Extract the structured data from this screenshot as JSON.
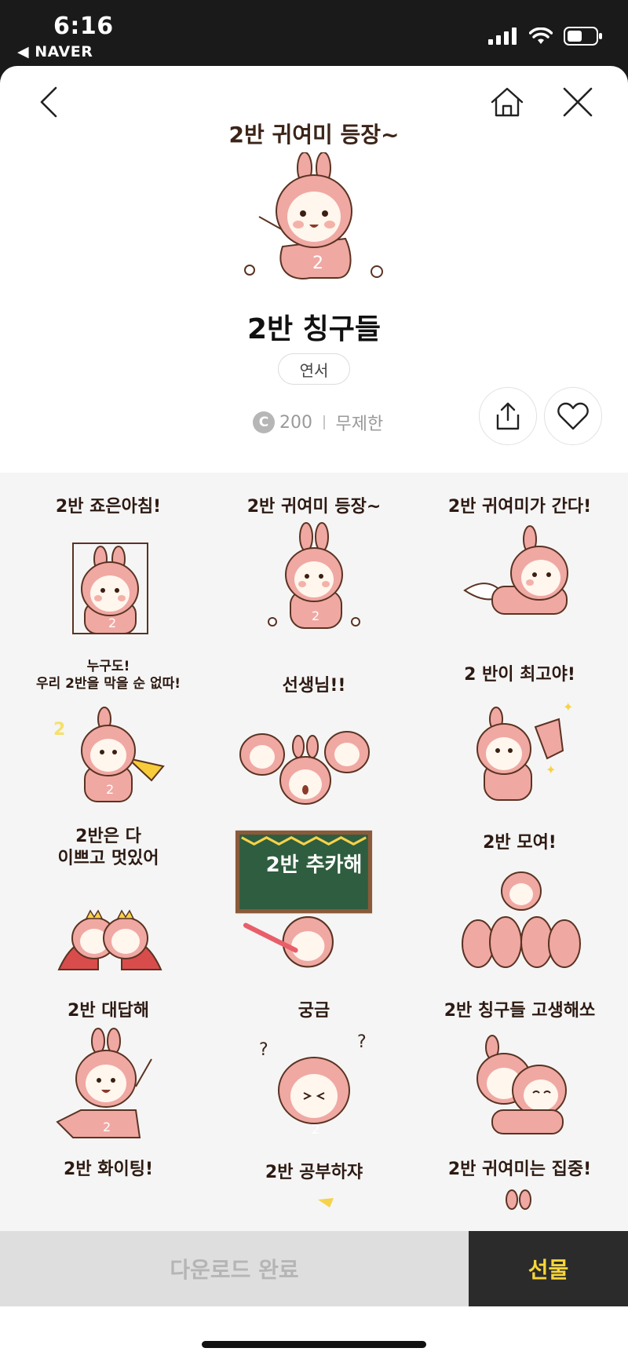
{
  "status_bar": {
    "time": "6:16",
    "back_app": "◀ NAVER"
  },
  "hero": {
    "caption": "2반 귀여미 등장~"
  },
  "title": "2반 칭구들",
  "author": "연서",
  "price": {
    "coin_symbol": "C",
    "amount": "200",
    "duration": "무제한"
  },
  "stickers": [
    {
      "label": "2반 죠은아침!"
    },
    {
      "label": "2반 귀여미 등장~"
    },
    {
      "label": "2반 귀여미가 간다!"
    },
    {
      "label": "누구도!\n우리 2반을 막을 순 없따!"
    },
    {
      "label": "선생님!!"
    },
    {
      "label": "2 반이 최고야!"
    },
    {
      "label": "2반은 다\n이쁘고 멋있어"
    },
    {
      "label": "2반 추카해"
    },
    {
      "label": "2반 모여!"
    },
    {
      "label": "2반 대답해"
    },
    {
      "label": "궁금"
    },
    {
      "label": "2반 칭구들 고생해쏘"
    },
    {
      "label": "2반 화이팅!"
    },
    {
      "label": "2반 공부하쟈"
    },
    {
      "label": "2반 귀여미는 집중!"
    }
  ],
  "bottom": {
    "download_label": "다운로드 완료",
    "gift_label": "선물"
  },
  "colors": {
    "accent_yellow": "#f8d53a",
    "bunny_pink": "#f0a8a3",
    "outline_brown": "#5a3322"
  }
}
